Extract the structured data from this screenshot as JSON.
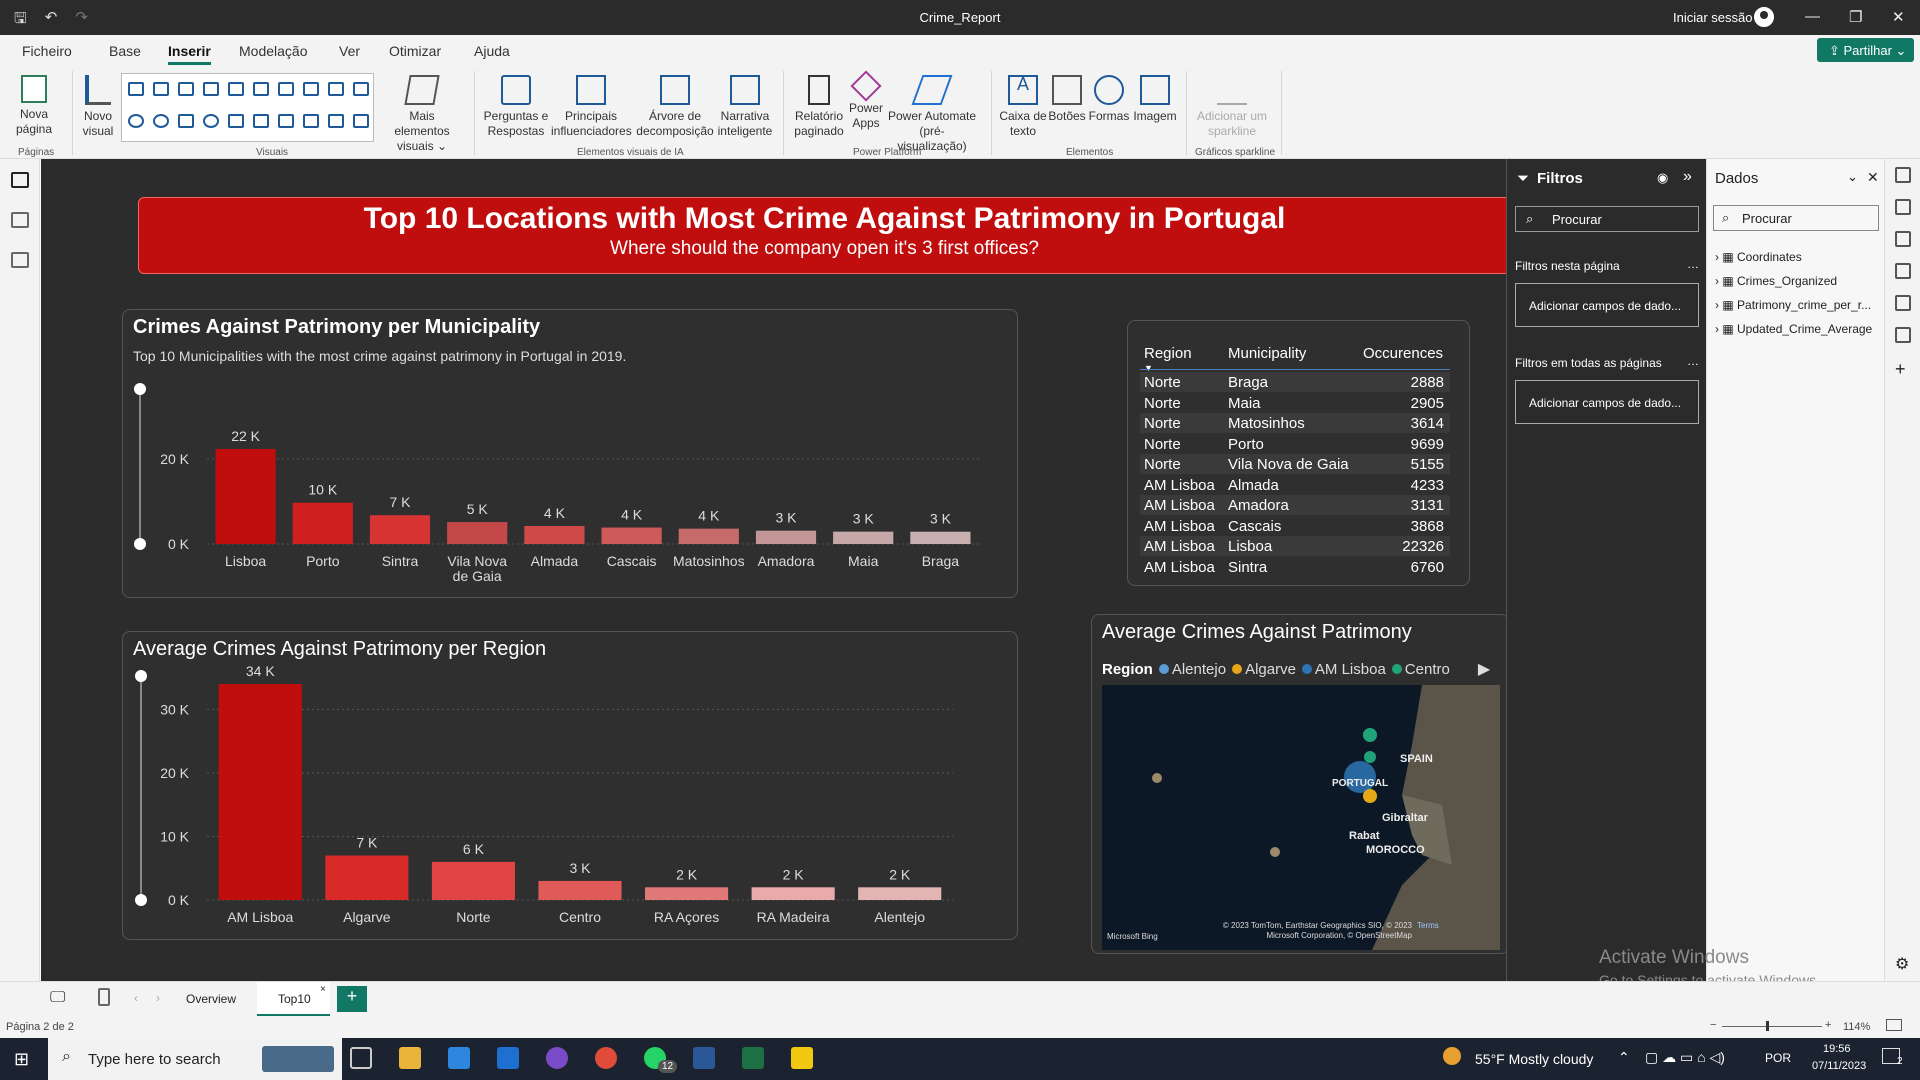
{
  "app": {
    "title": "Crime_Report",
    "signin": "Iniciar sessão"
  },
  "menu": {
    "items": [
      "Ficheiro",
      "Base",
      "Inserir",
      "Modelação",
      "Ver",
      "Otimizar",
      "Ajuda"
    ],
    "active": "Inserir",
    "share": "Partilhar"
  },
  "ribbon": {
    "nova_pagina": "Nova página",
    "novo_visual": "Novo visual",
    "mais_elementos": "Mais elementos visuais",
    "perguntas": "Perguntas e Respostas",
    "principais": "Principais influenciadores",
    "arvore": "Árvore de decomposição",
    "narrativa": "Narrativa inteligente",
    "relatorio": "Relatório paginado",
    "power_apps": "Power Apps",
    "power_automate": "Power Automate (pré-visualização)",
    "caixa": "Caixa de texto",
    "botoes": "Botões",
    "formas": "Formas",
    "imagem": "Imagem",
    "sparkline": "Adicionar um sparkline",
    "groups": {
      "paginas": "Páginas",
      "visuais": "Visuais",
      "ia": "Elementos visuais de IA",
      "platform": "Power Platform",
      "elementos": "Elementos",
      "sparkline": "Gráficos sparkline"
    }
  },
  "report": {
    "banner_title": "Top 10 Locations with Most Crime Against Patrimony in Portugal",
    "banner_subtitle": "Where should the company open it's 3 first offices?"
  },
  "chart_data": [
    {
      "type": "bar",
      "title": "Crimes Against Patrimony per Municipality",
      "subtitle": "Top 10 Municipalities with the most crime against patrimony in Portugal in 2019.",
      "categories": [
        "Lisboa",
        "Porto",
        "Sintra",
        "Vila Nova de Gaia",
        "Almada",
        "Cascais",
        "Matosinhos",
        "Amadora",
        "Maia",
        "Braga"
      ],
      "values": [
        22326,
        9699,
        6760,
        5155,
        4233,
        3868,
        3614,
        3131,
        2905,
        2888
      ],
      "data_labels": [
        "22 K",
        "10 K",
        "7 K",
        "5 K",
        "4 K",
        "4 K",
        "4 K",
        "3 K",
        "3 K",
        "3 K"
      ],
      "yticks": [
        "0 K",
        "20 K"
      ],
      "ylim": [
        0,
        22326
      ],
      "colors": [
        "#c00d0d",
        "#d01f1f",
        "#d83434",
        "#c44848",
        "#d04a4a",
        "#cf5a5a",
        "#c66a6a",
        "#c29696",
        "#c7a8a8",
        "#c9b0b0"
      ]
    },
    {
      "type": "bar",
      "title": "Average Crimes Against Patrimony per Region",
      "categories": [
        "AM Lisboa",
        "Algarve",
        "Norte",
        "Centro",
        "RA Açores",
        "RA Madeira",
        "Alentejo"
      ],
      "values": [
        34,
        7,
        6,
        3,
        2,
        2,
        2
      ],
      "data_labels": [
        "34 K",
        "7 K",
        "6 K",
        "3 K",
        "2 K",
        "2 K",
        "2 K"
      ],
      "yticks": [
        "0 K",
        "10 K",
        "20 K",
        "30 K"
      ],
      "ylim": [
        0,
        34
      ],
      "colors": [
        "#c00d0d",
        "#d92a2a",
        "#e04444",
        "#e05a5a",
        "#e17878",
        "#e8aaaa",
        "#e3b4b4"
      ]
    },
    {
      "type": "table",
      "columns": [
        "Region",
        "Municipality",
        "Occurences"
      ],
      "rows": [
        [
          "Norte",
          "Braga",
          "2888"
        ],
        [
          "Norte",
          "Maia",
          "2905"
        ],
        [
          "Norte",
          "Matosinhos",
          "3614"
        ],
        [
          "Norte",
          "Porto",
          "9699"
        ],
        [
          "Norte",
          "Vila Nova de Gaia",
          "5155"
        ],
        [
          "AM Lisboa",
          "Almada",
          "4233"
        ],
        [
          "AM Lisboa",
          "Amadora",
          "3131"
        ],
        [
          "AM Lisboa",
          "Cascais",
          "3868"
        ],
        [
          "AM Lisboa",
          "Lisboa",
          "22326"
        ],
        [
          "AM Lisboa",
          "Sintra",
          "6760"
        ]
      ]
    }
  ],
  "map": {
    "title": "Average Crimes Against Patrimony",
    "legend_title": "Region",
    "legend": [
      {
        "name": "Alentejo",
        "color": "#5b9bd5"
      },
      {
        "name": "Algarve",
        "color": "#e6a817"
      },
      {
        "name": "AM Lisboa",
        "color": "#2e75b6"
      },
      {
        "name": "Centro",
        "color": "#21a37a"
      }
    ],
    "labels": {
      "spain": "SPAIN",
      "portugal": "PORTUGAL",
      "gibraltar": "Gibraltar",
      "rabat": "Rabat",
      "morocco": "MOROCCO"
    },
    "attribution": "© 2023 TomTom, Earthstar Geographics SIO, © 2023 Microsoft Corporation, © OpenStreetMap",
    "terms": "Terms",
    "bing": "Microsoft Bing"
  },
  "filters": {
    "title": "Filtros",
    "search": "Procurar",
    "this_page": "Filtros nesta página",
    "all_pages": "Filtros em todas as páginas",
    "add_fields": "Adicionar campos de dado..."
  },
  "data_pane": {
    "title": "Dados",
    "search": "Procurar",
    "tables": [
      "Coordinates",
      "Crimes_Organized",
      "Patrimony_crime_per_r...",
      "Updated_Crime_Average"
    ]
  },
  "tabs": {
    "items": [
      "Overview",
      "Top10"
    ],
    "active": "Top10"
  },
  "status": {
    "page": "Página 2 de 2",
    "zoom": "114%"
  },
  "activate": {
    "line1": "Activate Windows",
    "line2": "Go to Settings to activate Windows."
  },
  "taskbar": {
    "search": "Type here to search",
    "weather": "55°F  Mostly cloudy",
    "lang": "POR",
    "time": "19:56",
    "date": "07/11/2023",
    "badge": "12",
    "notif": "2"
  }
}
